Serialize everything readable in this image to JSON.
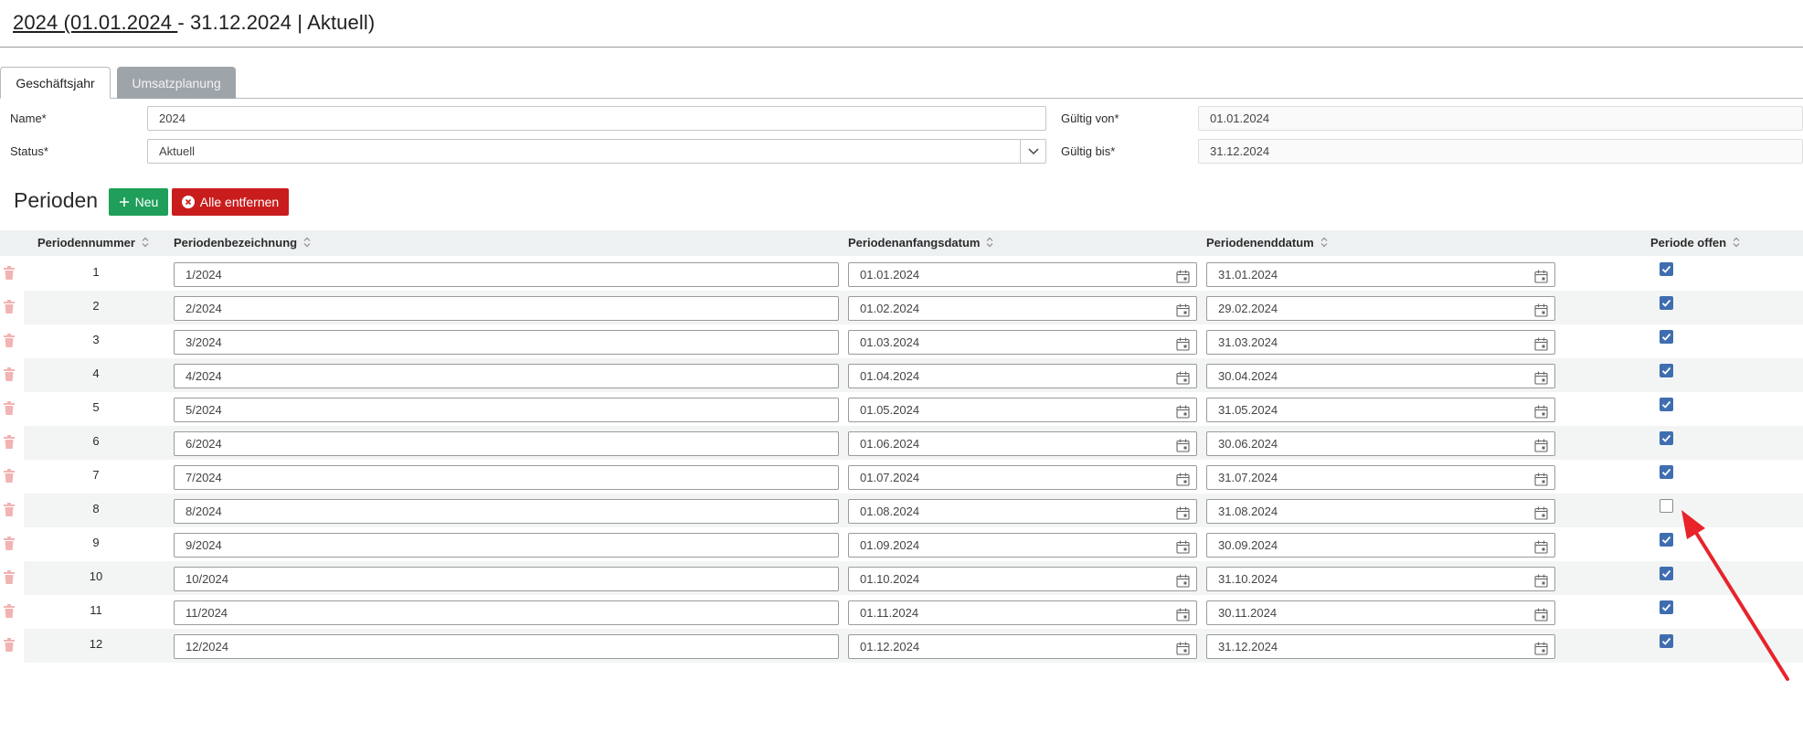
{
  "header": {
    "title_link": "2024 (01.01.2024 ",
    "title_rest": "- 31.12.2024 | Aktuell)"
  },
  "tabs": [
    {
      "label": "Geschäftsjahr",
      "active": true
    },
    {
      "label": "Umsatzplanung",
      "active": false
    }
  ],
  "form": {
    "name_label": "Name*",
    "name_value": "2024",
    "status_label": "Status*",
    "status_value": "Aktuell",
    "valid_from_label": "Gültig von*",
    "valid_from_value": "01.01.2024",
    "valid_to_label": "Gültig bis*",
    "valid_to_value": "31.12.2024"
  },
  "periods": {
    "title": "Perioden",
    "new_label": "Neu",
    "remove_all_label": "Alle entfernen",
    "columns": [
      "Periodennummer",
      "Periodenbezeichnung",
      "Periodenanfangsdatum",
      "Periodenenddatum",
      "Periode offen"
    ],
    "rows": [
      {
        "nr": "1",
        "name": "1/2024",
        "start": "01.01.2024",
        "end": "31.01.2024",
        "open": true
      },
      {
        "nr": "2",
        "name": "2/2024",
        "start": "01.02.2024",
        "end": "29.02.2024",
        "open": true
      },
      {
        "nr": "3",
        "name": "3/2024",
        "start": "01.03.2024",
        "end": "31.03.2024",
        "open": true
      },
      {
        "nr": "4",
        "name": "4/2024",
        "start": "01.04.2024",
        "end": "30.04.2024",
        "open": true
      },
      {
        "nr": "5",
        "name": "5/2024",
        "start": "01.05.2024",
        "end": "31.05.2024",
        "open": true
      },
      {
        "nr": "6",
        "name": "6/2024",
        "start": "01.06.2024",
        "end": "30.06.2024",
        "open": true
      },
      {
        "nr": "7",
        "name": "7/2024",
        "start": "01.07.2024",
        "end": "31.07.2024",
        "open": true
      },
      {
        "nr": "8",
        "name": "8/2024",
        "start": "01.08.2024",
        "end": "31.08.2024",
        "open": false
      },
      {
        "nr": "9",
        "name": "9/2024",
        "start": "01.09.2024",
        "end": "30.09.2024",
        "open": true
      },
      {
        "nr": "10",
        "name": "10/2024",
        "start": "01.10.2024",
        "end": "31.10.2024",
        "open": true
      },
      {
        "nr": "11",
        "name": "11/2024",
        "start": "01.11.2024",
        "end": "30.11.2024",
        "open": true
      },
      {
        "nr": "12",
        "name": "12/2024",
        "start": "01.12.2024",
        "end": "31.12.2024",
        "open": true
      }
    ]
  },
  "colors": {
    "checkbox_checked": "#3f6eb0",
    "button_new": "#1f9f5a",
    "button_remove": "#c91d1d",
    "tab_inactive": "#9ea5aa",
    "trash_icon": "#f2b3b3",
    "annotation_arrow": "#e8232a"
  }
}
